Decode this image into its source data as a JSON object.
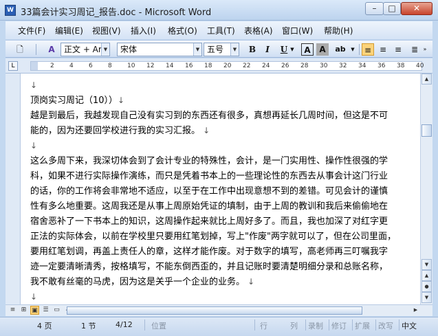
{
  "window": {
    "title": "33篇会计实习周记_报告.doc - Microsoft Word",
    "icon_label": "W",
    "minimize": "–",
    "maximize": "□",
    "close": "✕"
  },
  "menu": [
    "文件(F)",
    "编辑(E)",
    "视图(V)",
    "插入(I)",
    "格式(O)",
    "工具(T)",
    "表格(A)",
    "窗口(W)",
    "帮助(H)"
  ],
  "toolbar": {
    "style": "正文 + Aria",
    "font": "宋体",
    "size": "五号",
    "bold": "B",
    "italic": "I",
    "underline": "U",
    "char_border": "A",
    "char_shading": "A",
    "highlight": "ab"
  },
  "ruler": {
    "corner": "L",
    "ticks": [
      "2",
      "4",
      "6",
      "8",
      "10",
      "12",
      "14",
      "16",
      "18",
      "20",
      "22",
      "24",
      "26",
      "28",
      "30",
      "32",
      "34",
      "36",
      "38",
      "40"
    ]
  },
  "document": {
    "lines": [
      {
        "text": "",
        "mark": "↓"
      },
      {
        "text": "顶岗实习周记（10））",
        "mark": "↓"
      },
      {
        "text": "越是到最后，我越发现自己没有实习到的东西还有很多，真想再延长几周时间，但这是不可",
        "mark": ""
      },
      {
        "text": "能的，因为还要回学校进行我的实习汇报。 ",
        "mark": "↓"
      },
      {
        "text": "",
        "mark": "↓"
      },
      {
        "text": "这么多周下来，我深切体会到了会计专业的特殊性，会计，是一门实用性、操作性很强的学",
        "mark": ""
      },
      {
        "text": "科，如果不进行实际操作演练，而只是凭着书本上的一些理论性的东西去从事会计这门行业",
        "mark": ""
      },
      {
        "text": "的话，你的工作将会非常地不适应，以至于在工作中出现意想不到的差错。可见会计的谨慎",
        "mark": ""
      },
      {
        "text": "性有多么地重要。这周我还是从事上周原始凭证的填制，由于上周的教训和我后来偷偷地在",
        "mark": ""
      },
      {
        "text": "宿舍恶补了一下书本上的知识，这周操作起来就比上周好多了。而且，我也加深了对红字更",
        "mark": ""
      },
      {
        "text": "正法的实际体会，以前在学校里只要用红笔划掉，写上\"作废\"两字就可以了，但在公司里面，",
        "mark": ""
      },
      {
        "text": "要用红笔划调，再盖上责任人的章，这样才能作废。对于数字的填写，高老师再三叮嘱我字",
        "mark": ""
      },
      {
        "text": "迹一定要清晰清秀，按格填写，不能东倒西歪的，并且记账时要清楚明细分录和总账名称，",
        "mark": ""
      },
      {
        "text": "我不敢有丝毫的马虎，因为这是关乎一个企业的业务。 ",
        "mark": "↓"
      },
      {
        "text": "",
        "mark": "↓"
      },
      {
        "text": "这一周实习下来，从制单到记账的整个过程基本上有了一个大概的了解，并结合书本知识总",
        "mark": ""
      }
    ]
  },
  "status": {
    "page": "4 页",
    "section": "1 节",
    "page_of": "4/12",
    "position": "位置",
    "row": "行",
    "col": "列",
    "rec": "录制",
    "trk": "修订",
    "ext": "扩展",
    "ovr": "改写",
    "lang": "中文"
  }
}
